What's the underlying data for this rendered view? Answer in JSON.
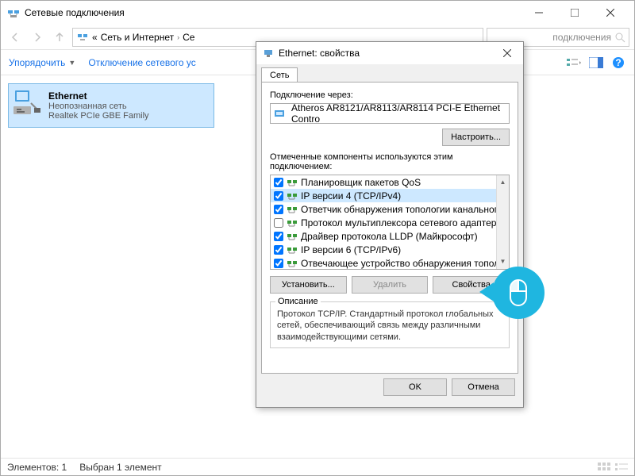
{
  "window": {
    "title": "Сетевые подключения"
  },
  "breadcrumb": {
    "prefix": "«",
    "part1": "Сеть и Интернет",
    "sep": "›",
    "part2": "Се"
  },
  "search": {
    "placeholder": "подключения"
  },
  "toolbar": {
    "organize": "Упорядочить",
    "disable": "Отключение сетевого ус"
  },
  "adapter": {
    "name": "Ethernet",
    "status": "Неопознанная сеть",
    "device": "Realtek PCIe GBE Family"
  },
  "statusbar": {
    "count": "Элементов: 1",
    "selected": "Выбран 1 элемент"
  },
  "dialog": {
    "title": "Ethernet: свойства",
    "tab_network": "Сеть",
    "connect_via": "Подключение через:",
    "adapter_name": "Atheros AR8121/AR8113/AR8114 PCI-E Ethernet Contro",
    "configure_btn": "Настроить...",
    "components_label": "Отмеченные компоненты используются этим подключением:",
    "components": [
      {
        "checked": true,
        "label": "Планировщик пакетов QoS",
        "selected": false
      },
      {
        "checked": true,
        "label": "IP версии 4 (TCP/IPv4)",
        "selected": true
      },
      {
        "checked": true,
        "label": "Ответчик обнаружения топологии канального уров",
        "selected": false
      },
      {
        "checked": false,
        "label": "Протокол мультиплексора сетевого адаптера (Ма",
        "selected": false
      },
      {
        "checked": true,
        "label": "Драйвер протокола LLDP (Майкрософт)",
        "selected": false
      },
      {
        "checked": true,
        "label": "IP версии 6 (TCP/IPv6)",
        "selected": false
      },
      {
        "checked": true,
        "label": "Отвечающее устройство обнаружения топологии к",
        "selected": false
      }
    ],
    "install_btn": "Установить...",
    "remove_btn": "Удалить",
    "properties_btn": "Свойства",
    "desc_legend": "Описание",
    "desc_text": "Протокол TCP/IP. Стандартный протокол глобальных сетей, обеспечивающий связь между различными взаимодействующими сетями.",
    "ok_btn": "OK",
    "cancel_btn": "Отмена"
  }
}
